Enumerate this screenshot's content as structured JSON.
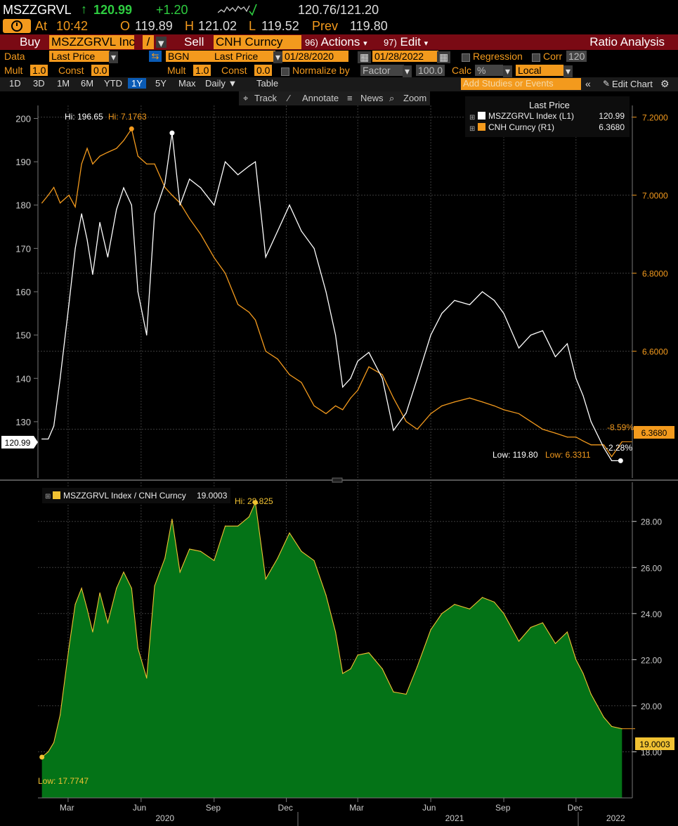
{
  "header": {
    "ticker": "MSZZGRVL",
    "last": "120.99",
    "change": "+1.20",
    "bidask": "120.76/121.20",
    "at_label": "At",
    "time": "10:42",
    "open_label": "O",
    "open": "119.89",
    "high_label": "H",
    "high": "121.02",
    "low_label": "L",
    "low": "119.52",
    "prev_label": "Prev",
    "prev": "119.80"
  },
  "actionbar": {
    "buy_label": "Buy",
    "buy_security": "MSZZGRVL Inc",
    "slash": "/",
    "sell_label": "Sell",
    "sell_security": "CNH Curncy",
    "actions_num": "96)",
    "actions_label": "Actions",
    "edit_num": "97)",
    "edit_label": "Edit",
    "title": "Ratio Analysis"
  },
  "settings": {
    "data_label": "Data",
    "data_value": "Last Price",
    "bgn_value": "BGN",
    "field_value": "Last Price",
    "date_from": "01/28/2020",
    "date_sep": "-",
    "date_to": "01/28/2022",
    "regression_label": "Regression",
    "corr_label": "Corr",
    "corr_value": "120",
    "mult_label": "Mult",
    "mult_value": "1.0",
    "const_label": "Const",
    "const_value": "0.0",
    "mult2_value": "1.0",
    "const2_value": "0.0",
    "normalize_label": "Normalize by",
    "factor_value": "Factor",
    "factor_num": "100.0",
    "calc_label": "Calc",
    "calc_value": "%",
    "local_value": "Local"
  },
  "tabs": [
    "1D",
    "3D",
    "1M",
    "6M",
    "YTD",
    "1Y",
    "5Y",
    "Max",
    "Daily ▼",
    "Table"
  ],
  "selected_tab": "1Y",
  "studies_placeholder": "Add Studies or Events",
  "edit_chart_label": "Edit Chart",
  "toolbar": {
    "track": "Track",
    "annotate": "Annotate",
    "news": "News",
    "zoom": "Zoom"
  },
  "colors": {
    "white_series": "#ffffff",
    "orange_series": "#f39a1d",
    "ratio_fill": "#047317",
    "ratio_line": "#f1c232",
    "panel_bg": "#000000",
    "grid": "#3c3c3c"
  },
  "chart_data": [
    {
      "type": "line",
      "legend_title": "Last Price",
      "series": [
        {
          "name": "MSZZGRVL Index (L1)",
          "legend_value": "120.99",
          "axis": "left",
          "x": [
            "2020-01-28",
            "2020-02-05",
            "2020-02-12",
            "2020-02-20",
            "2020-03-02",
            "2020-03-10",
            "2020-03-18",
            "2020-03-25",
            "2020-04-01",
            "2020-04-10",
            "2020-04-20",
            "2020-05-01",
            "2020-05-10",
            "2020-05-20",
            "2020-05-28",
            "2020-06-08",
            "2020-06-18",
            "2020-07-01",
            "2020-07-10",
            "2020-07-20",
            "2020-08-01",
            "2020-08-15",
            "2020-09-01",
            "2020-09-15",
            "2020-10-01",
            "2020-10-15",
            "2020-10-23",
            "2020-11-05",
            "2020-11-20",
            "2020-12-05",
            "2020-12-20",
            "2021-01-05",
            "2021-01-20",
            "2021-02-01",
            "2021-02-10",
            "2021-02-20",
            "2021-03-01",
            "2021-03-15",
            "2021-04-01",
            "2021-04-15",
            "2021-05-01",
            "2021-05-15",
            "2021-06-01",
            "2021-06-15",
            "2021-07-01",
            "2021-07-20",
            "2021-08-05",
            "2021-08-20",
            "2021-09-01",
            "2021-09-20",
            "2021-10-05",
            "2021-10-20",
            "2021-11-05",
            "2021-11-20",
            "2021-12-01",
            "2021-12-10",
            "2021-12-20",
            "2022-01-05",
            "2022-01-15",
            "2022-01-28"
          ],
          "y": [
            126,
            126,
            129,
            140,
            157,
            170,
            178,
            172,
            164,
            176,
            168,
            179,
            184,
            180,
            160,
            150,
            178,
            185,
            196.65,
            180,
            186,
            184,
            180,
            190,
            187,
            189,
            190,
            168,
            174,
            180,
            174,
            170,
            160,
            150,
            138,
            140,
            144,
            146,
            140,
            128,
            132,
            140,
            150,
            155,
            158,
            157,
            160,
            158,
            155,
            147,
            150,
            151,
            145,
            148,
            140,
            136,
            130,
            124,
            121,
            120.99
          ],
          "hi_label": "Hi: 196.65",
          "low_label": "Low: 119.80",
          "change_label": "-2.28%",
          "axis_tag": "120.99"
        },
        {
          "name": "CNH Curncy (R1)",
          "legend_value": "6.3680",
          "axis": "right",
          "x": [
            "2020-01-28",
            "2020-02-05",
            "2020-02-12",
            "2020-02-20",
            "2020-03-02",
            "2020-03-10",
            "2020-03-18",
            "2020-03-25",
            "2020-04-01",
            "2020-04-10",
            "2020-04-20",
            "2020-05-01",
            "2020-05-10",
            "2020-05-20",
            "2020-05-28",
            "2020-06-08",
            "2020-06-18",
            "2020-07-01",
            "2020-07-10",
            "2020-07-20",
            "2020-08-01",
            "2020-08-15",
            "2020-09-01",
            "2020-09-15",
            "2020-10-01",
            "2020-10-15",
            "2020-10-23",
            "2020-11-05",
            "2020-11-20",
            "2020-12-05",
            "2020-12-20",
            "2021-01-05",
            "2021-01-20",
            "2021-02-01",
            "2021-02-10",
            "2021-02-20",
            "2021-03-01",
            "2021-03-15",
            "2021-04-01",
            "2021-04-15",
            "2021-05-01",
            "2021-05-15",
            "2021-06-01",
            "2021-06-15",
            "2021-07-01",
            "2021-07-20",
            "2021-08-05",
            "2021-08-20",
            "2021-09-01",
            "2021-09-20",
            "2021-10-05",
            "2021-10-20",
            "2021-11-05",
            "2021-11-20",
            "2021-12-01",
            "2021-12-10",
            "2021-12-20",
            "2022-01-05",
            "2022-01-15",
            "2022-01-28"
          ],
          "y": [
            6.98,
            7.0,
            7.02,
            6.98,
            7.0,
            6.97,
            7.08,
            7.12,
            7.08,
            7.1,
            7.11,
            7.12,
            7.14,
            7.17,
            7.1,
            7.08,
            7.08,
            7.02,
            7.0,
            6.98,
            6.94,
            6.9,
            6.84,
            6.8,
            6.72,
            6.7,
            6.68,
            6.6,
            6.58,
            6.54,
            6.52,
            6.46,
            6.44,
            6.46,
            6.45,
            6.48,
            6.5,
            6.56,
            6.54,
            6.48,
            6.42,
            6.4,
            6.44,
            6.46,
            6.47,
            6.48,
            6.47,
            6.46,
            6.45,
            6.44,
            6.42,
            6.4,
            6.39,
            6.38,
            6.38,
            6.37,
            6.36,
            6.36,
            6.33,
            6.368
          ],
          "hi_label": "Hi: 7.1763",
          "low_label": "Low: 6.3311",
          "change_label": "-8.59%",
          "axis_tag": "6.3680"
        }
      ],
      "left_ticks": [
        130,
        140,
        150,
        160,
        170,
        180,
        190,
        200
      ],
      "right_ticks": [
        "6.4000",
        "6.6000",
        "6.8000",
        "7.0000",
        "7.2000"
      ],
      "left_ylim": [
        117,
        203
      ],
      "right_ylim": [
        6.275,
        7.23
      ],
      "grid": true,
      "legend_position": "top-right"
    },
    {
      "type": "area",
      "series": [
        {
          "name": "MSZZGRVL Index / CNH Curncy",
          "legend_value": "19.0003",
          "x": [
            "2020-01-28",
            "2020-02-05",
            "2020-02-12",
            "2020-02-20",
            "2020-03-02",
            "2020-03-10",
            "2020-03-18",
            "2020-03-25",
            "2020-04-01",
            "2020-04-10",
            "2020-04-20",
            "2020-05-01",
            "2020-05-10",
            "2020-05-20",
            "2020-05-28",
            "2020-06-08",
            "2020-06-18",
            "2020-07-01",
            "2020-07-10",
            "2020-07-20",
            "2020-08-01",
            "2020-08-15",
            "2020-09-01",
            "2020-09-15",
            "2020-10-01",
            "2020-10-15",
            "2020-10-23",
            "2020-11-05",
            "2020-11-20",
            "2020-12-05",
            "2020-12-20",
            "2021-01-05",
            "2021-01-20",
            "2021-02-01",
            "2021-02-10",
            "2021-02-20",
            "2021-03-01",
            "2021-03-15",
            "2021-04-01",
            "2021-04-15",
            "2021-05-01",
            "2021-05-15",
            "2021-06-01",
            "2021-06-15",
            "2021-07-01",
            "2021-07-20",
            "2021-08-05",
            "2021-08-20",
            "2021-09-01",
            "2021-09-20",
            "2021-10-05",
            "2021-10-20",
            "2021-11-05",
            "2021-11-20",
            "2021-12-01",
            "2021-12-10",
            "2021-12-20",
            "2022-01-05",
            "2022-01-15",
            "2022-01-28"
          ],
          "y": [
            17.77,
            18.0,
            18.4,
            19.6,
            22.5,
            24.4,
            25.1,
            24.2,
            23.2,
            24.9,
            23.6,
            25.1,
            25.8,
            25.1,
            22.5,
            21.2,
            25.2,
            26.4,
            28.1,
            25.8,
            26.8,
            26.7,
            26.3,
            27.8,
            27.8,
            28.2,
            28.825,
            25.5,
            26.4,
            27.5,
            26.7,
            26.3,
            24.8,
            23.2,
            21.4,
            21.6,
            22.2,
            22.3,
            21.6,
            20.6,
            20.5,
            21.7,
            23.3,
            24.0,
            24.4,
            24.2,
            24.7,
            24.5,
            24.0,
            22.8,
            23.4,
            23.6,
            22.7,
            23.2,
            22.0,
            21.4,
            20.5,
            19.5,
            19.1,
            19.0003
          ],
          "hi_label": "Hi: 28.825",
          "low_label": "Low: 17.7747",
          "axis_tag": "19.0003"
        }
      ],
      "right_ticks": [
        "18.00",
        "20.00",
        "22.00",
        "24.00",
        "26.00",
        "28.00"
      ],
      "ylim": [
        16.0,
        29.7
      ],
      "grid": true
    }
  ],
  "x_axis": {
    "months": [
      "Mar",
      "Jun",
      "Sep",
      "Dec",
      "Mar",
      "Jun",
      "Sep",
      "Dec"
    ],
    "month_dates": [
      "2020-03-01",
      "2020-06-01",
      "2020-09-01",
      "2020-12-01",
      "2021-03-01",
      "2021-06-01",
      "2021-09-01",
      "2021-12-01"
    ],
    "years": [
      "2020",
      "2021",
      "2022"
    ],
    "year_dates": [
      "2020-07-01",
      "2021-07-01",
      "2022-01-20"
    ],
    "x_range": [
      "2020-01-23",
      "2022-02-10"
    ]
  }
}
